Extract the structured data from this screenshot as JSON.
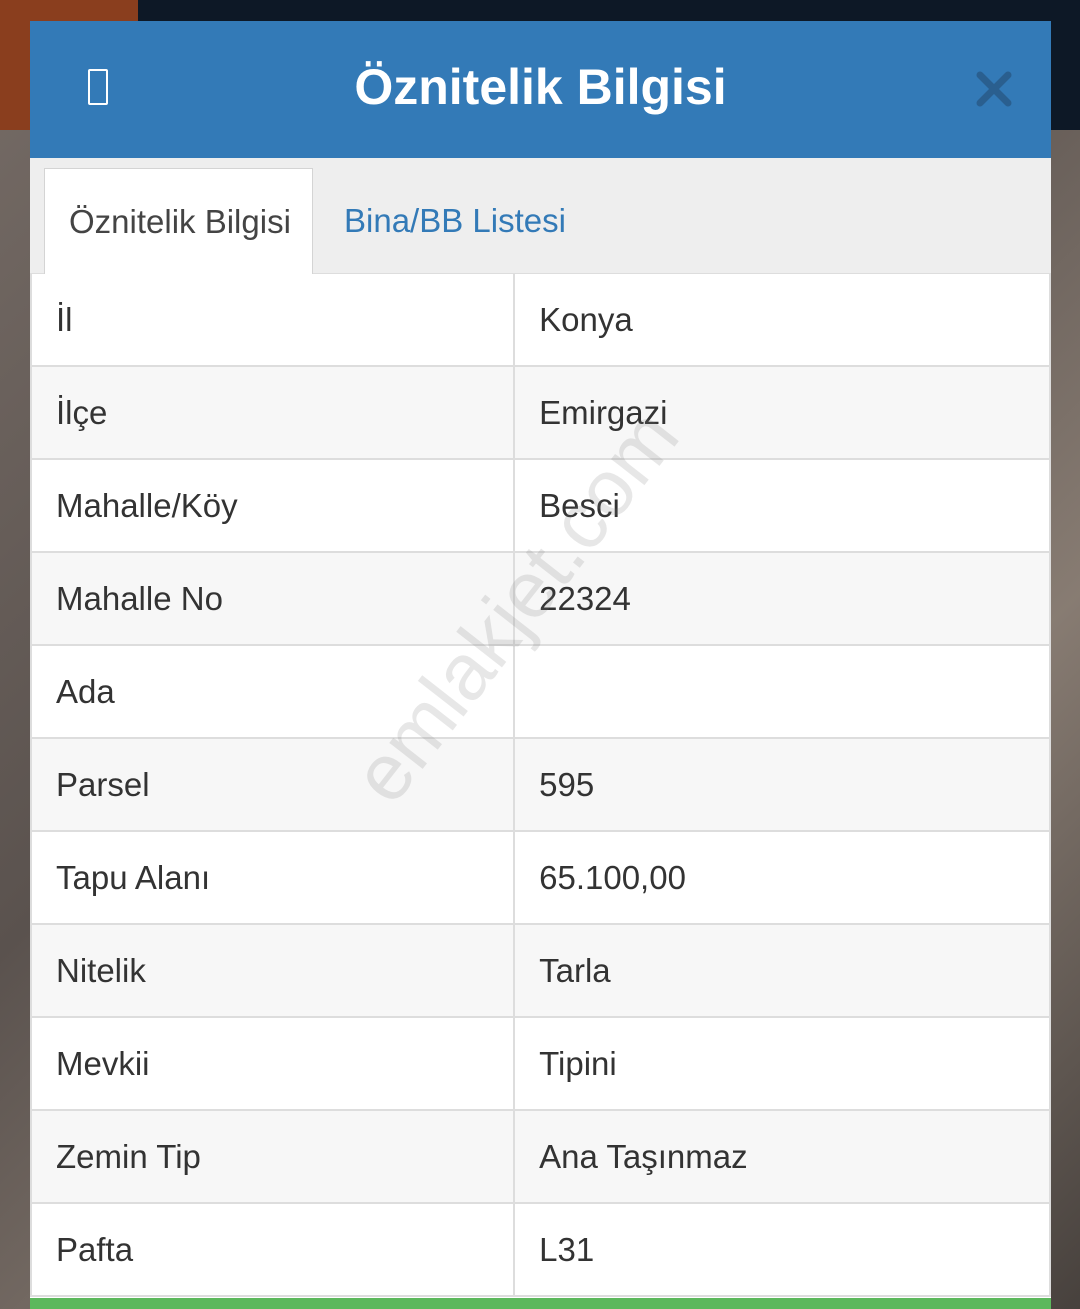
{
  "modal": {
    "title": "Öznitelik Bilgisi",
    "left_icon": "window-icon",
    "close_icon": "close-icon"
  },
  "tabs": [
    {
      "label": "Öznitelik Bilgisi",
      "active": true
    },
    {
      "label": "Bina/BB Listesi",
      "active": false
    }
  ],
  "rows": [
    {
      "key": "İl",
      "value": "Konya"
    },
    {
      "key": "İlçe",
      "value": "Emirgazi"
    },
    {
      "key": "Mahalle/Köy",
      "value": "Besci"
    },
    {
      "key": "Mahalle No",
      "value": "22324"
    },
    {
      "key": "Ada",
      "value": ""
    },
    {
      "key": "Parsel",
      "value": "595"
    },
    {
      "key": "Tapu Alanı",
      "value": "65.100,00"
    },
    {
      "key": "Nitelik",
      "value": "Tarla"
    },
    {
      "key": "Mevkii",
      "value": "Tipini"
    },
    {
      "key": "Zemin Tip",
      "value": "Ana Taşınmaz"
    },
    {
      "key": "Pafta",
      "value": "L31"
    }
  ],
  "watermark": "emlakjet.com",
  "colors": {
    "header": "#337ab7",
    "tab_link": "#337ab7",
    "footer": "#5cb85c"
  }
}
